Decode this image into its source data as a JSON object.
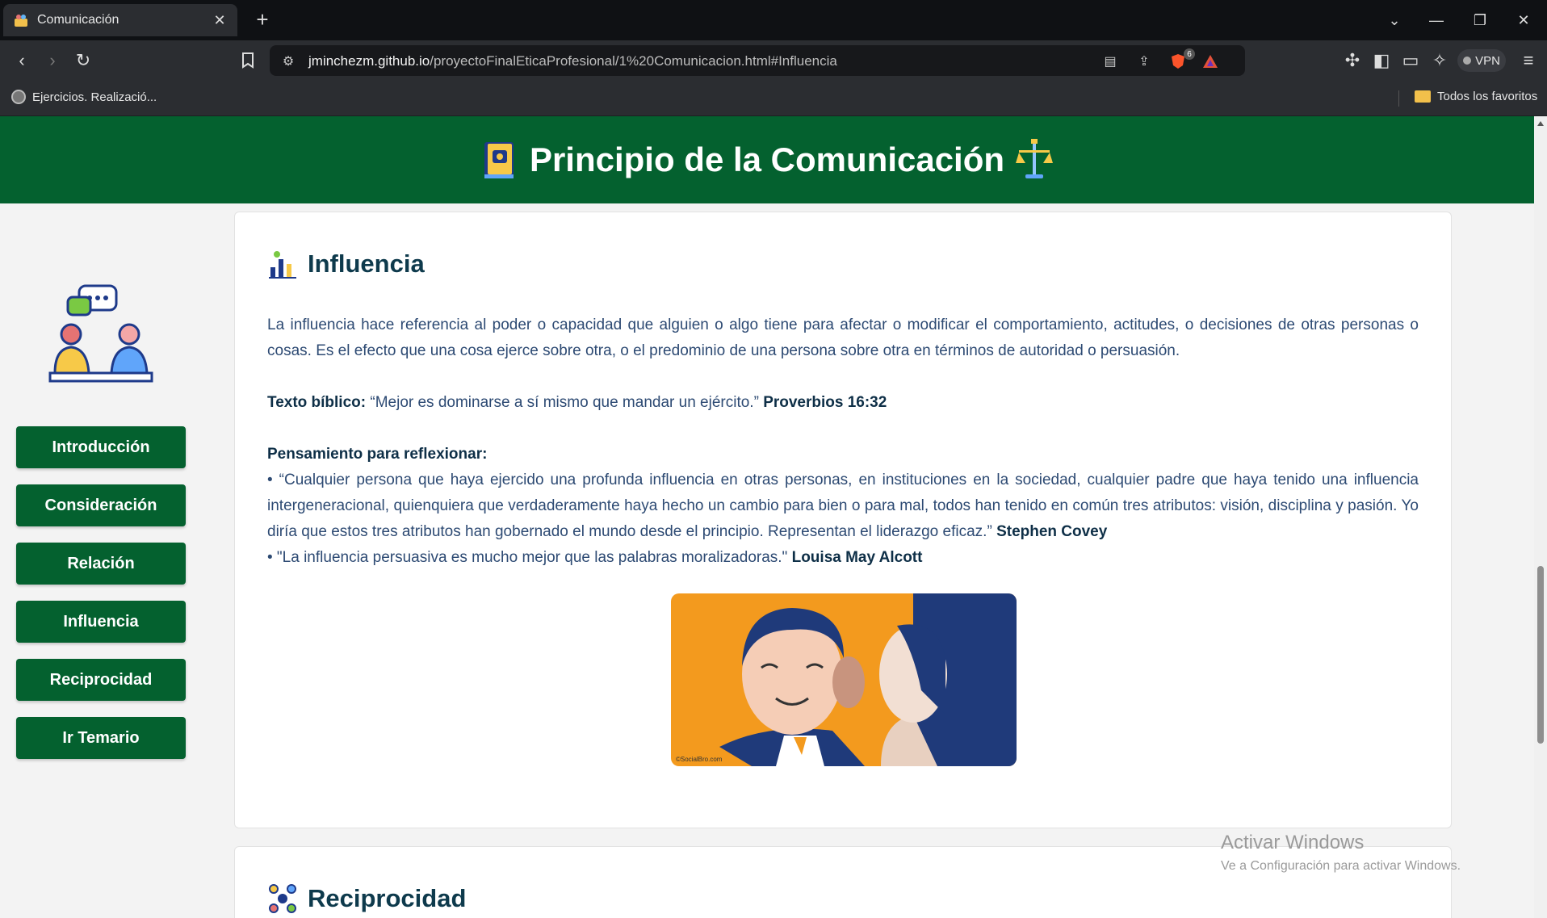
{
  "browser": {
    "tab_title": "Comunicación",
    "url_host": "jminchezm.github.io",
    "url_path": "/proyectoFinalEticaProfesional/1%20Comunicacion.html#Influencia",
    "vpn_label": "VPN",
    "shield_badge": "6",
    "bookmark_left": "Ejercicios. Realizació...",
    "bookmark_right": "Todos los favoritos"
  },
  "header": {
    "title": "Principio de la Comunicación"
  },
  "sidebar": {
    "items": [
      {
        "label": "Introducción"
      },
      {
        "label": "Consideración"
      },
      {
        "label": "Relación"
      },
      {
        "label": "Influencia"
      },
      {
        "label": "Reciprocidad"
      },
      {
        "label": "Ir Temario"
      }
    ]
  },
  "section_influencia": {
    "title": "Influencia",
    "definition": "La influencia hace referencia al poder o capacidad que alguien o algo tiene para afectar o modificar el comportamiento, actitudes, o decisiones de otras personas o cosas. Es el efecto que una cosa ejerce sobre otra, o el predominio de una persona sobre otra en términos de autoridad o persuasión.",
    "bible_label": "Texto bíblico:",
    "bible_quote": " “Mejor es dominarse a sí mismo que mandar un ejército.” ",
    "bible_ref": "Proverbios 16:32",
    "reflect_label": "Pensamiento para reflexionar:",
    "quote1": "• “Cualquier persona que haya ejercido una profunda influencia en otras personas, en instituciones en la sociedad, cualquier padre que haya tenido una influencia intergeneracional, quienquiera que verdaderamente haya hecho un cambio para bien o para mal, todos han tenido en común tres atributos: visión, disciplina y pasión. Yo diría que estos tres atributos han gobernado el mundo desde el principio. Representan el liderazgo eficaz.” ",
    "quote1_author": "Stephen Covey",
    "quote2": "• \"La influencia persuasiva es mucho mejor que las palabras moralizadoras.\" ",
    "quote2_author": "Louisa May Alcott",
    "image_credit": "©SocialBro.com"
  },
  "section_reciprocidad": {
    "title": "Reciprocidad"
  },
  "watermark": {
    "line1": "Activar Windows",
    "line2": "Ve a Configuración para activar Windows."
  },
  "colors": {
    "brand_green": "#04612f",
    "heading": "#0e3a4c",
    "body_text": "#2d4a73"
  }
}
